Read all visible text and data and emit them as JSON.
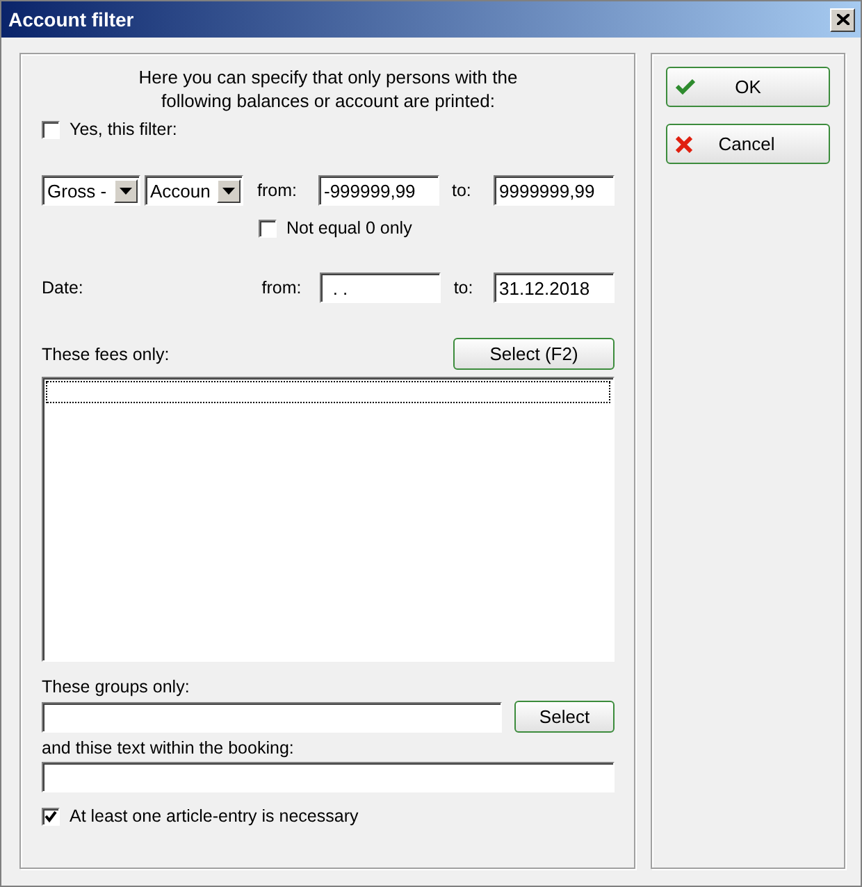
{
  "window": {
    "title": "Account filter"
  },
  "intro": "Here you can specify that only persons with the following balances or account are printed:",
  "filter_checkbox": {
    "label": "Yes, this filter:",
    "checked": false
  },
  "balance": {
    "type_dropdown": "Gross -",
    "account_dropdown": "Accoun",
    "from_label": "from:",
    "from": "-999999,99",
    "to_label": "to:",
    "to": "9999999,99"
  },
  "not_equal_zero": {
    "label": "Not equal 0 only",
    "checked": false
  },
  "date": {
    "label": "Date:",
    "from_label": "from:",
    "from": ". .",
    "to_label": "to:",
    "to": "31.12.2018"
  },
  "fees": {
    "label": "These fees only:",
    "button": "Select (F2)"
  },
  "groups": {
    "label": "These groups only:",
    "button": "Select"
  },
  "booking_text": {
    "label": "and thise text within the booking:"
  },
  "article_checkbox": {
    "label": "At least one article-entry is necessary",
    "checked": true
  },
  "buttons": [
    {
      "label": "OK",
      "kind": "ok"
    },
    {
      "label": "Cancel",
      "kind": "cancel"
    }
  ]
}
